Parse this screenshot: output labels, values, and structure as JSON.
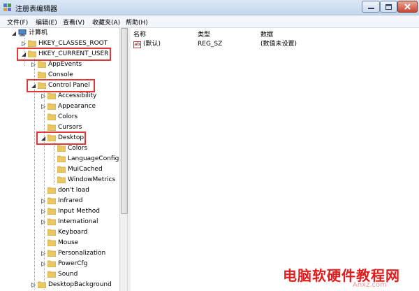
{
  "window": {
    "title": "注册表编辑器",
    "buttons": [
      "minimize",
      "maximize",
      "close"
    ]
  },
  "menu": [
    "文件(F)",
    "编辑(E)",
    "查看(V)",
    "收藏夹(A)",
    "帮助(H)"
  ],
  "list": {
    "columns": [
      "名称",
      "类型",
      "数据"
    ],
    "rows": [
      {
        "name": "(默认)",
        "type": "REG_SZ",
        "data": "(数值未设置)",
        "icon": "string-value-icon"
      }
    ]
  },
  "tree": [
    {
      "label": "计算机",
      "icon": "computer-icon",
      "expanded": true,
      "highlight": false
    },
    {
      "label": "HKEY_CLASSES_ROOT",
      "icon": "folder-icon",
      "expanded": false,
      "highlight": false
    },
    {
      "label": "HKEY_CURRENT_USER",
      "icon": "folder-icon",
      "expanded": true,
      "highlight": true
    },
    {
      "label": "AppEvents",
      "icon": "folder-icon",
      "expanded": false,
      "highlight": false
    },
    {
      "label": "Console",
      "icon": "folder-icon",
      "expanded": null,
      "highlight": false
    },
    {
      "label": "Control Panel",
      "icon": "folder-icon",
      "expanded": true,
      "highlight": true
    },
    {
      "label": "Accessibility",
      "icon": "folder-icon",
      "expanded": false,
      "highlight": false
    },
    {
      "label": "Appearance",
      "icon": "folder-icon",
      "expanded": false,
      "highlight": false
    },
    {
      "label": "Colors",
      "icon": "folder-icon",
      "expanded": null,
      "highlight": false
    },
    {
      "label": "Cursors",
      "icon": "folder-icon",
      "expanded": null,
      "highlight": false
    },
    {
      "label": "Desktop",
      "icon": "folder-icon",
      "expanded": true,
      "highlight": true
    },
    {
      "label": "Colors",
      "icon": "folder-icon",
      "expanded": null,
      "highlight": false
    },
    {
      "label": "LanguageConfig",
      "icon": "folder-icon",
      "expanded": null,
      "highlight": false
    },
    {
      "label": "MuiCached",
      "icon": "folder-icon",
      "expanded": null,
      "highlight": false
    },
    {
      "label": "WindowMetrics",
      "icon": "folder-icon",
      "expanded": null,
      "highlight": false
    },
    {
      "label": "don't load",
      "icon": "folder-icon",
      "expanded": null,
      "highlight": false
    },
    {
      "label": "Infrared",
      "icon": "folder-icon",
      "expanded": false,
      "highlight": false
    },
    {
      "label": "Input Method",
      "icon": "folder-icon",
      "expanded": false,
      "highlight": false
    },
    {
      "label": "International",
      "icon": "folder-icon",
      "expanded": false,
      "highlight": false
    },
    {
      "label": "Keyboard",
      "icon": "folder-icon",
      "expanded": null,
      "highlight": false
    },
    {
      "label": "Mouse",
      "icon": "folder-icon",
      "expanded": null,
      "highlight": false
    },
    {
      "label": "Personalization",
      "icon": "folder-icon",
      "expanded": false,
      "highlight": false
    },
    {
      "label": "PowerCfg",
      "icon": "folder-icon",
      "expanded": false,
      "highlight": false
    },
    {
      "label": "Sound",
      "icon": "folder-icon",
      "expanded": null,
      "highlight": false
    },
    {
      "label": "DesktopBackground",
      "icon": "folder-icon",
      "expanded": false,
      "highlight": false
    }
  ],
  "watermark": {
    "text": "电脑软硬件教程网",
    "sub": "Anxz.com"
  },
  "colors": {
    "highlight_box": "#e23838",
    "folder": "#e9c863",
    "titlebar": "#c4d6ec",
    "watermark": "#e21c1c"
  }
}
